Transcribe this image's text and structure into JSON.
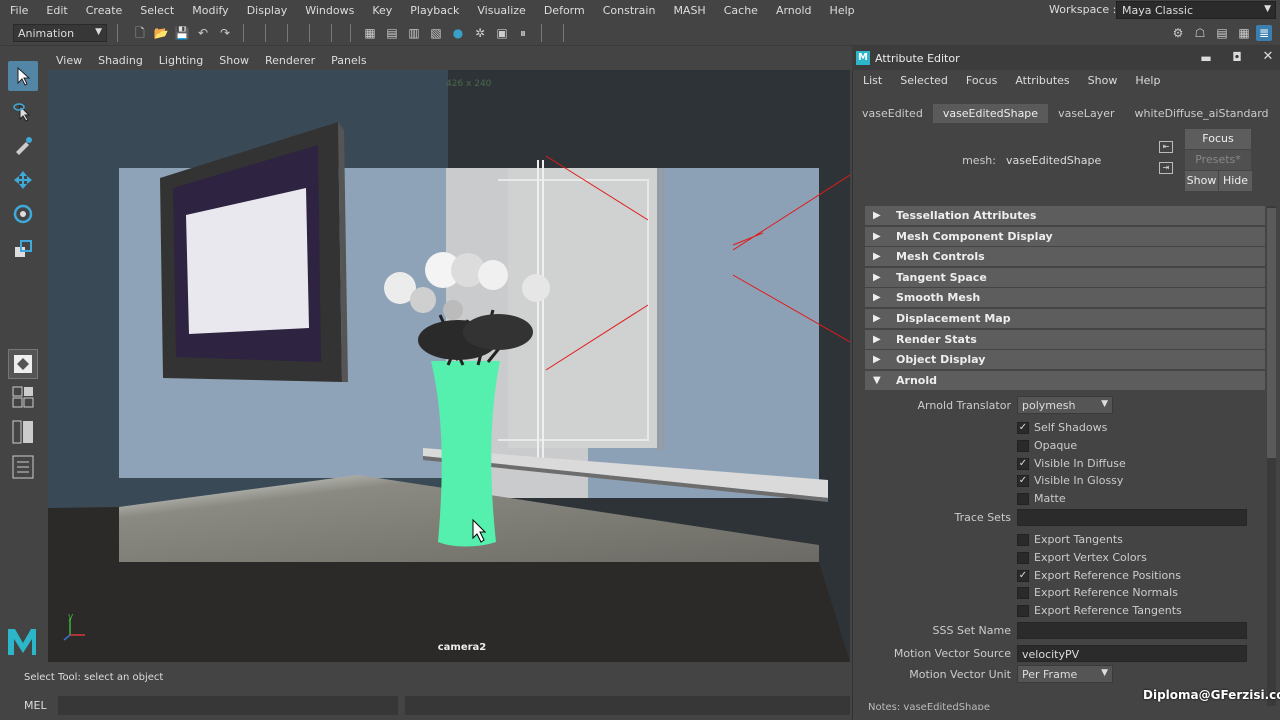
{
  "menubar": {
    "items": [
      "File",
      "Edit",
      "Create",
      "Select",
      "Modify",
      "Display",
      "Windows",
      "Key",
      "Playback",
      "Visualize",
      "Deform",
      "Constrain",
      "MASH",
      "Cache",
      "Arnold",
      "Help"
    ],
    "workspace_label": "Workspace :",
    "workspace_value": "Maya Classic"
  },
  "statusline": {
    "mode": "Animation"
  },
  "viewport": {
    "menu": [
      "View",
      "Shading",
      "Lighting",
      "Show",
      "Renderer",
      "Panels"
    ],
    "resolution_gate": "426 x 240",
    "camera_label": "camera2",
    "vase_color": "#55f0ad",
    "wall_color": "#8fa3b8"
  },
  "help_line": {
    "text": "Select Tool: select an object"
  },
  "mel": {
    "label": "MEL"
  },
  "attribute_editor": {
    "title": "Attribute Editor",
    "menu": [
      "List",
      "Selected",
      "Focus",
      "Attributes",
      "Show",
      "Help"
    ],
    "tabs": [
      "vaseEdited",
      "vaseEditedShape",
      "vaseLayer",
      "whiteDiffuse_aiStandard"
    ],
    "active_tab": 1,
    "mesh_label": "mesh:",
    "mesh_value": "vaseEditedShape",
    "buttons": {
      "focus": "Focus",
      "presets": "Presets*",
      "show": "Show",
      "hide": "Hide"
    },
    "sections": [
      "Tessellation Attributes",
      "Mesh Component Display",
      "Mesh Controls",
      "Tangent Space",
      "Smooth Mesh",
      "Displacement Map",
      "Render Stats",
      "Object Display",
      "Arnold"
    ],
    "arnold": {
      "translator_label": "Arnold Translator",
      "translator_value": "polymesh",
      "checks_a": [
        {
          "label": "Self Shadows",
          "checked": true
        },
        {
          "label": "Opaque",
          "checked": false
        },
        {
          "label": "Visible In Diffuse",
          "checked": true
        },
        {
          "label": "Visible In Glossy",
          "checked": true
        },
        {
          "label": "Matte",
          "checked": false
        }
      ],
      "trace_sets_label": "Trace Sets",
      "trace_sets_value": "",
      "checks_b": [
        {
          "label": "Export Tangents",
          "checked": false
        },
        {
          "label": "Export Vertex Colors",
          "checked": false
        },
        {
          "label": "Export Reference Positions",
          "checked": true
        },
        {
          "label": "Export Reference Normals",
          "checked": false
        },
        {
          "label": "Export Reference Tangents",
          "checked": false
        }
      ],
      "sss_label": "SSS Set Name",
      "sss_value": "",
      "mv_source_label": "Motion Vector Source",
      "mv_source_value": "velocityPV",
      "mv_unit_label": "Motion Vector Unit",
      "mv_unit_value": "Per Frame"
    },
    "notes_label": "Notes: vaseEditedShape"
  },
  "watermark": "Diploma@GFerzisi.com"
}
